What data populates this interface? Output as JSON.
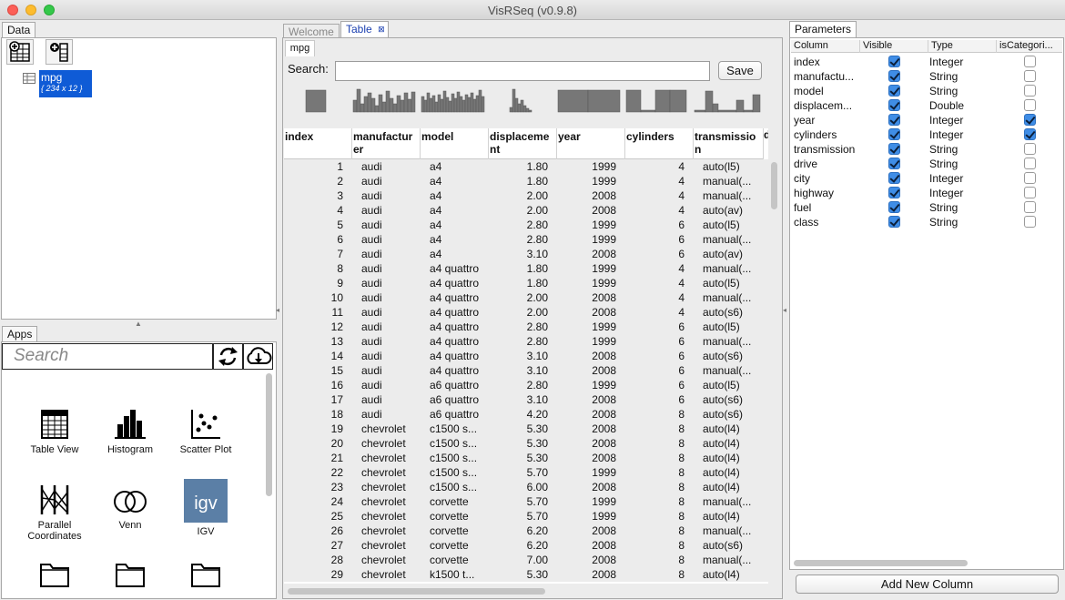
{
  "window": {
    "title": "VisRSeq (v0.9.8)"
  },
  "data_panel": {
    "tab": "Data",
    "tree": {
      "name": "mpg",
      "meta": "{ 234 x 12 }"
    }
  },
  "apps_panel": {
    "tab": "Apps",
    "search_placeholder": "Search",
    "apps": [
      {
        "label": "Table View",
        "icon": "table-view-icon"
      },
      {
        "label": "Histogram",
        "icon": "histogram-icon"
      },
      {
        "label": "Scatter Plot",
        "icon": "scatter-plot-icon"
      },
      {
        "label": "Parallel Coordinates",
        "icon": "parallel-coordinates-icon"
      },
      {
        "label": "Venn",
        "icon": "venn-icon"
      },
      {
        "label": "IGV",
        "icon": "igv-icon"
      }
    ],
    "igv_logo_text": "igv"
  },
  "center": {
    "tabs": [
      {
        "label": "Welcome"
      },
      {
        "label": "Table"
      }
    ],
    "subtab": "mpg",
    "search_label": "Search:",
    "search_value": "",
    "save_label": "Save",
    "columns": [
      "index",
      "manufacturer",
      "model",
      "displacement",
      "year",
      "cylinders",
      "transmission"
    ],
    "rows": [
      [
        "1",
        "audi",
        "a4",
        "1.80",
        "1999",
        "4",
        "auto(l5)"
      ],
      [
        "2",
        "audi",
        "a4",
        "1.80",
        "1999",
        "4",
        "manual(..."
      ],
      [
        "3",
        "audi",
        "a4",
        "2.00",
        "2008",
        "4",
        "manual(..."
      ],
      [
        "4",
        "audi",
        "a4",
        "2.00",
        "2008",
        "4",
        "auto(av)"
      ],
      [
        "5",
        "audi",
        "a4",
        "2.80",
        "1999",
        "6",
        "auto(l5)"
      ],
      [
        "6",
        "audi",
        "a4",
        "2.80",
        "1999",
        "6",
        "manual(..."
      ],
      [
        "7",
        "audi",
        "a4",
        "3.10",
        "2008",
        "6",
        "auto(av)"
      ],
      [
        "8",
        "audi",
        "a4 quattro",
        "1.80",
        "1999",
        "4",
        "manual(..."
      ],
      [
        "9",
        "audi",
        "a4 quattro",
        "1.80",
        "1999",
        "4",
        "auto(l5)"
      ],
      [
        "10",
        "audi",
        "a4 quattro",
        "2.00",
        "2008",
        "4",
        "manual(..."
      ],
      [
        "11",
        "audi",
        "a4 quattro",
        "2.00",
        "2008",
        "4",
        "auto(s6)"
      ],
      [
        "12",
        "audi",
        "a4 quattro",
        "2.80",
        "1999",
        "6",
        "auto(l5)"
      ],
      [
        "13",
        "audi",
        "a4 quattro",
        "2.80",
        "1999",
        "6",
        "manual(..."
      ],
      [
        "14",
        "audi",
        "a4 quattro",
        "3.10",
        "2008",
        "6",
        "auto(s6)"
      ],
      [
        "15",
        "audi",
        "a4 quattro",
        "3.10",
        "2008",
        "6",
        "manual(..."
      ],
      [
        "16",
        "audi",
        "a6 quattro",
        "2.80",
        "1999",
        "6",
        "auto(l5)"
      ],
      [
        "17",
        "audi",
        "a6 quattro",
        "3.10",
        "2008",
        "6",
        "auto(s6)"
      ],
      [
        "18",
        "audi",
        "a6 quattro",
        "4.20",
        "2008",
        "8",
        "auto(s6)"
      ],
      [
        "19",
        "chevrolet",
        "c1500 s...",
        "5.30",
        "2008",
        "8",
        "auto(l4)"
      ],
      [
        "20",
        "chevrolet",
        "c1500 s...",
        "5.30",
        "2008",
        "8",
        "auto(l4)"
      ],
      [
        "21",
        "chevrolet",
        "c1500 s...",
        "5.30",
        "2008",
        "8",
        "auto(l4)"
      ],
      [
        "22",
        "chevrolet",
        "c1500 s...",
        "5.70",
        "1999",
        "8",
        "auto(l4)"
      ],
      [
        "23",
        "chevrolet",
        "c1500 s...",
        "6.00",
        "2008",
        "8",
        "auto(l4)"
      ],
      [
        "24",
        "chevrolet",
        "corvette",
        "5.70",
        "1999",
        "8",
        "manual(..."
      ],
      [
        "25",
        "chevrolet",
        "corvette",
        "5.70",
        "1999",
        "8",
        "auto(l4)"
      ],
      [
        "26",
        "chevrolet",
        "corvette",
        "6.20",
        "2008",
        "8",
        "manual(..."
      ],
      [
        "27",
        "chevrolet",
        "corvette",
        "6.20",
        "2008",
        "8",
        "auto(s6)"
      ],
      [
        "28",
        "chevrolet",
        "corvette",
        "7.00",
        "2008",
        "8",
        "manual(..."
      ],
      [
        "29",
        "chevrolet",
        "k1500 t...",
        "5.30",
        "2008",
        "8",
        "auto(l4)"
      ]
    ]
  },
  "parameters": {
    "tab": "Parameters",
    "headers": [
      "Column",
      "Visible",
      "Type",
      "isCategori..."
    ],
    "rows": [
      {
        "column": "index",
        "visible": true,
        "type": "Integer",
        "categorical": false
      },
      {
        "column": "manufactu...",
        "visible": true,
        "type": "String",
        "categorical": false
      },
      {
        "column": "model",
        "visible": true,
        "type": "String",
        "categorical": false
      },
      {
        "column": "displacem...",
        "visible": true,
        "type": "Double",
        "categorical": false
      },
      {
        "column": "year",
        "visible": true,
        "type": "Integer",
        "categorical": true
      },
      {
        "column": "cylinders",
        "visible": true,
        "type": "Integer",
        "categorical": true
      },
      {
        "column": "transmission",
        "visible": true,
        "type": "String",
        "categorical": false
      },
      {
        "column": "drive",
        "visible": true,
        "type": "String",
        "categorical": false
      },
      {
        "column": "city",
        "visible": true,
        "type": "Integer",
        "categorical": false
      },
      {
        "column": "highway",
        "visible": true,
        "type": "Integer",
        "categorical": false
      },
      {
        "column": "fuel",
        "visible": true,
        "type": "String",
        "categorical": false
      },
      {
        "column": "class",
        "visible": true,
        "type": "String",
        "categorical": false
      }
    ],
    "add_column_label": "Add New Column"
  },
  "colors": {
    "selection": "#0f5bd6",
    "checkbox_on": "#3f8de6",
    "tab_active_text": "#1a3fb0"
  }
}
